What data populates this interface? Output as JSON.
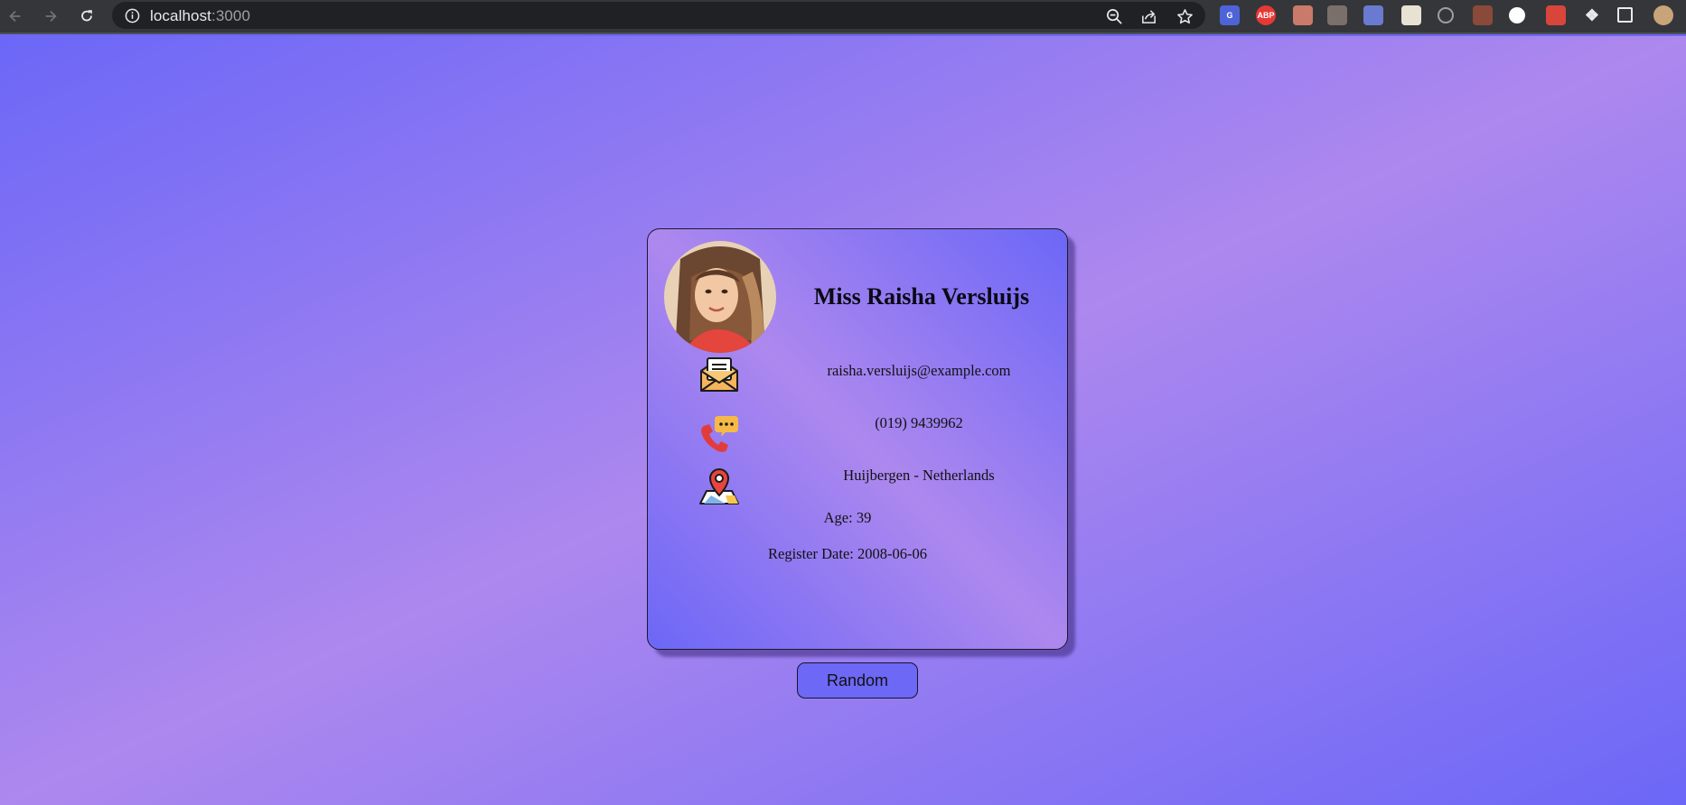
{
  "browser": {
    "url_host": "localhost",
    "url_port": ":3000",
    "icons": {
      "back": "arrow-left-icon",
      "forward": "arrow-right-icon",
      "reload": "reload-icon",
      "info": "info-icon",
      "zoom": "zoom-out-icon",
      "share": "share-icon",
      "bookmark": "star-icon"
    },
    "extensions": [
      {
        "name": "google-translate-icon",
        "label": "G",
        "color": "#4f63d9"
      },
      {
        "name": "adblock-plus-icon",
        "label": "ABP",
        "color": "#e53935"
      },
      {
        "name": "glasses-extension-icon",
        "label": "",
        "color": "#c97a6a"
      },
      {
        "name": "figure-extension-icon",
        "label": "",
        "color": "#7a6f6a"
      },
      {
        "name": "pen-extension-icon",
        "label": "",
        "color": "#6a7ad0"
      },
      {
        "name": "calendar-extension-icon",
        "label": "",
        "color": "#e8e2d4"
      },
      {
        "name": "compass-extension-icon",
        "label": "",
        "color": "#35363a"
      },
      {
        "name": "ninja-extension-icon",
        "label": "",
        "color": "#8a4a3a"
      },
      {
        "name": "github-extension-icon",
        "label": "",
        "color": "#ffffff"
      },
      {
        "name": "bug-extension-icon",
        "label": "",
        "color": "#d8453a"
      },
      {
        "name": "puzzle-extensions-icon",
        "label": "",
        "color": "#35363a"
      },
      {
        "name": "side-panel-icon",
        "label": "",
        "color": "#35363a"
      },
      {
        "name": "profile-avatar-icon",
        "label": "",
        "color": "#c8a47a"
      }
    ]
  },
  "profile": {
    "name": "Miss Raisha Versluijs",
    "email": "raisha.versluijs@example.com",
    "phone": "(019) 9439962",
    "location": "Huijbergen - Netherlands",
    "age_text": "Age: 39",
    "register_text": "Register Date: 2008-06-06",
    "icons": {
      "avatar": "avatar-photo",
      "email": "email-envelope-icon",
      "phone": "phone-chat-icon",
      "location": "map-pin-icon"
    }
  },
  "actions": {
    "random_label": "Random"
  },
  "colors": {
    "gradient_a": "#6c67f7",
    "gradient_b": "#ad88ee",
    "button_bg": "#6d68f6"
  }
}
